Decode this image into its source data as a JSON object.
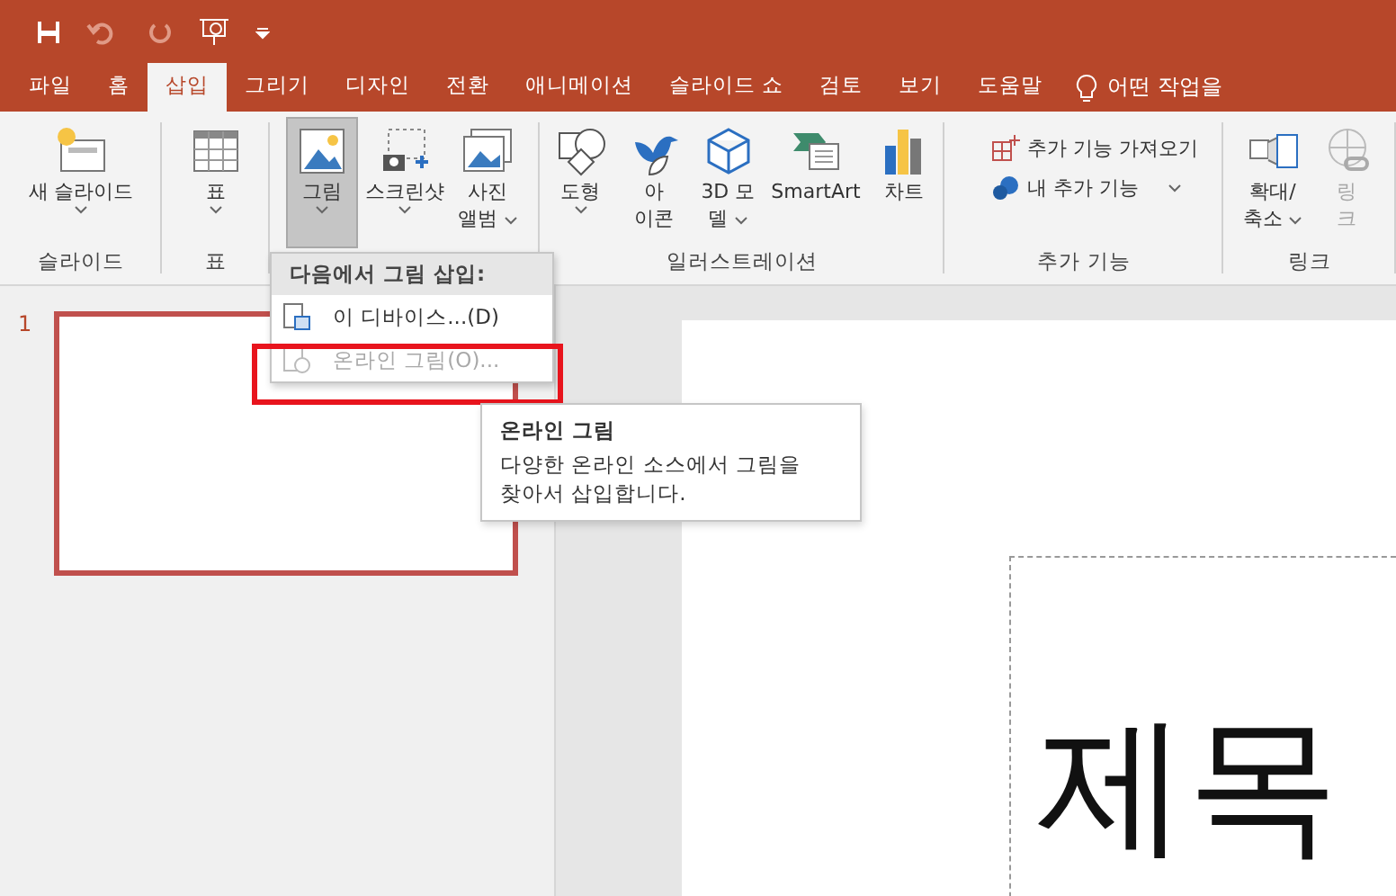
{
  "tabs": [
    {
      "label": "파일",
      "selected": false
    },
    {
      "label": "홈",
      "selected": false
    },
    {
      "label": "삽입",
      "selected": true
    },
    {
      "label": "그리기",
      "selected": false
    },
    {
      "label": "디자인",
      "selected": false
    },
    {
      "label": "전환",
      "selected": false
    },
    {
      "label": "애니메이션",
      "selected": false
    },
    {
      "label": "슬라이드 쇼",
      "selected": false
    },
    {
      "label": "검토",
      "selected": false
    },
    {
      "label": "보기",
      "selected": false
    },
    {
      "label": "도움말",
      "selected": false
    }
  ],
  "tell_me": {
    "placeholder": "어떤 작업을"
  },
  "ribbon_groups": [
    {
      "label": "슬라이드",
      "items": [
        {
          "kind": "large",
          "lines": [
            "새 슬라이드"
          ],
          "has_menu": true,
          "pressed": false,
          "disabled": false
        }
      ]
    },
    {
      "label": "표",
      "items": [
        {
          "kind": "large",
          "lines": [
            "표"
          ],
          "has_menu": true,
          "pressed": false,
          "disabled": false
        }
      ]
    },
    {
      "items": [
        {
          "kind": "large",
          "lines": [
            "그림"
          ],
          "has_menu": true,
          "pressed": true,
          "disabled": false
        },
        {
          "kind": "large",
          "lines": [
            "스크린샷"
          ],
          "has_menu": true,
          "pressed": false,
          "disabled": false
        },
        {
          "kind": "large",
          "lines": [
            "사진",
            "앨범"
          ],
          "has_menu": true,
          "pressed": false,
          "disabled": false
        }
      ]
    },
    {
      "label": "일러스트레이션",
      "items": [
        {
          "kind": "large",
          "lines": [
            "도형"
          ],
          "has_menu": true,
          "pressed": false,
          "disabled": false
        },
        {
          "kind": "large",
          "lines": [
            "아",
            "이콘"
          ],
          "has_menu": false,
          "pressed": false,
          "disabled": false
        },
        {
          "kind": "large",
          "lines": [
            "3D 모",
            "델"
          ],
          "has_menu": true,
          "pressed": false,
          "disabled": false
        },
        {
          "kind": "large",
          "lines": [
            "SmartArt"
          ],
          "has_menu": false,
          "pressed": false,
          "disabled": false
        },
        {
          "kind": "large",
          "lines": [
            "차트"
          ],
          "has_menu": false,
          "pressed": false,
          "disabled": false
        }
      ]
    },
    {
      "label": "추가 기능",
      "items": [
        {
          "kind": "small",
          "lines": [
            "추가 기능 가져오기"
          ],
          "has_menu": false
        },
        {
          "kind": "small",
          "lines": [
            "내 추가 기능"
          ],
          "has_menu": true
        }
      ]
    },
    {
      "label": "링크",
      "items": [
        {
          "kind": "large",
          "lines": [
            "확대/",
            "축소"
          ],
          "has_menu": true,
          "pressed": false,
          "disabled": false
        },
        {
          "kind": "large",
          "lines": [
            "링",
            "크"
          ],
          "has_menu": false,
          "pressed": false,
          "disabled": true
        }
      ]
    }
  ],
  "dropdown": {
    "header": "다음에서 그림 삽입:",
    "items": [
      {
        "label": "이 디바이스...(D)",
        "disabled": false
      },
      {
        "label": "온라인 그림(O)...",
        "disabled": true,
        "highlighted": true
      }
    ]
  },
  "tooltip": {
    "title": "온라인 그림",
    "body": "다양한 온라인 소스에서 그림을 찾아서 삽입합니다."
  },
  "thumbnails": [
    {
      "number": "1",
      "selected": true
    }
  ],
  "slide": {
    "title": "제목"
  }
}
